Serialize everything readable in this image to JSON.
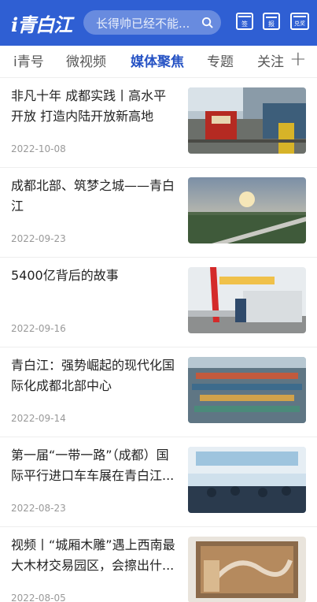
{
  "header": {
    "logo_text": "i青白江",
    "search_placeholder": "长得帅已经不能...",
    "icons": [
      "calendar-sign-icon",
      "newspaper-icon",
      "prize-icon"
    ],
    "icon_labels": {
      "sign": "签",
      "paper": "报",
      "prize": "兑奖"
    }
  },
  "tabs": [
    {
      "label": "i青号",
      "active": false
    },
    {
      "label": "微视频",
      "active": false
    },
    {
      "label": "媒体聚焦",
      "active": true
    },
    {
      "label": "专题",
      "active": false
    },
    {
      "label": "关注",
      "active": false
    }
  ],
  "tabs_more": "+",
  "articles": [
    {
      "title": "非凡十年 成都实践丨高水平开放 打造内陆开放新高地",
      "date": "2022-10-08"
    },
    {
      "title": "成都北部、筑梦之城——青白江",
      "date": "2022-09-23"
    },
    {
      "title": "5400亿背后的故事",
      "date": "2022-09-16"
    },
    {
      "title": "青白江：强势崛起的现代化国际化成都北部中心",
      "date": "2022-09-14"
    },
    {
      "title": "第一届“一带一路”（成都）国际平行进口车车展在青白江...",
      "date": "2022-08-23"
    },
    {
      "title": "视频丨“城厢木雕”遇上西南最大木材交易园区，会擦出什...",
      "date": "2022-08-05"
    }
  ],
  "colors": {
    "brand": "#2f5fd3",
    "active_tab": "#2552c4"
  }
}
